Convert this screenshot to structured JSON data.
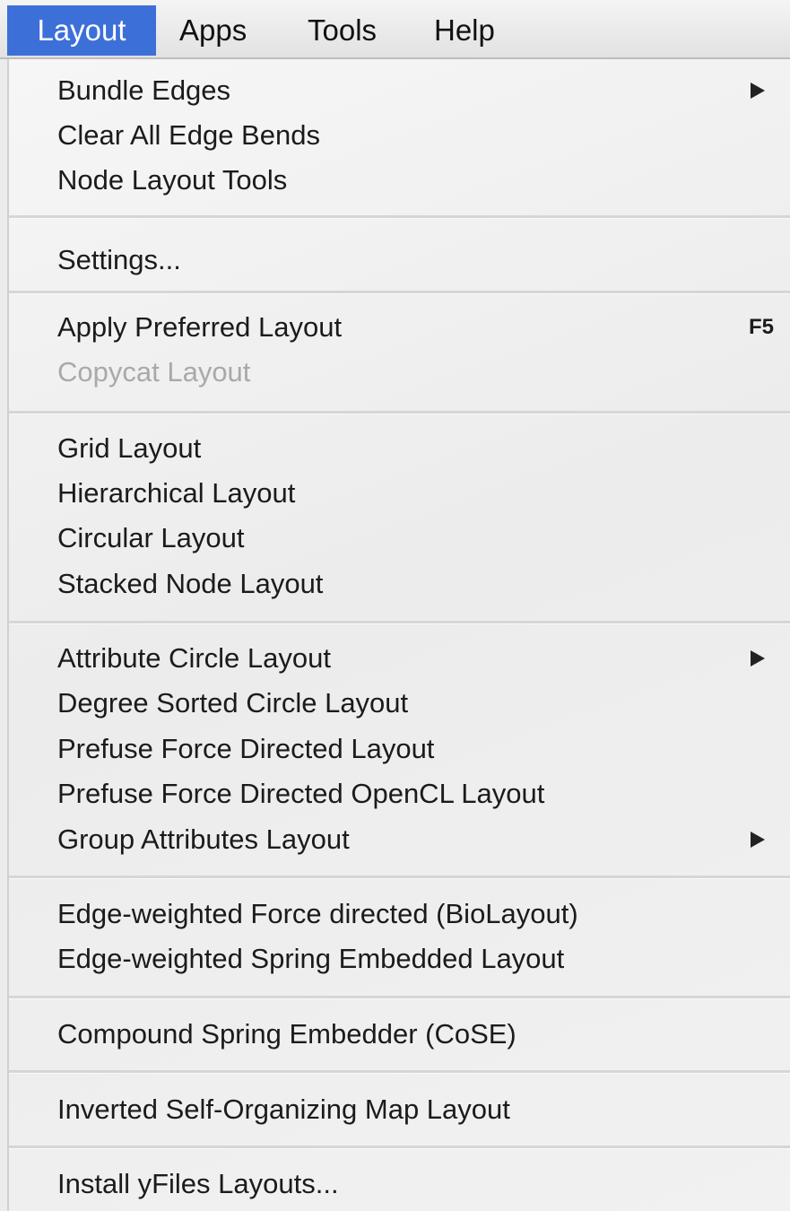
{
  "menubar": {
    "items": [
      "Layout",
      "Apps",
      "Tools",
      "Help"
    ]
  },
  "menu": {
    "groups": [
      {
        "items": [
          {
            "label": "Bundle Edges",
            "submenu": true
          },
          {
            "label": "Clear All Edge Bends"
          },
          {
            "label": "Node Layout Tools"
          }
        ]
      },
      {
        "items": [
          {
            "label": "Settings..."
          }
        ]
      },
      {
        "items": [
          {
            "label": "Apply Preferred Layout",
            "shortcut": "F5"
          },
          {
            "label": "Copycat Layout",
            "disabled": true
          }
        ]
      },
      {
        "items": [
          {
            "label": "Grid Layout"
          },
          {
            "label": "Hierarchical Layout"
          },
          {
            "label": "Circular Layout"
          },
          {
            "label": "Stacked Node Layout"
          }
        ]
      },
      {
        "items": [
          {
            "label": "Attribute Circle Layout",
            "submenu": true
          },
          {
            "label": "Degree Sorted Circle Layout"
          },
          {
            "label": "Prefuse Force Directed Layout"
          },
          {
            "label": "Prefuse Force Directed OpenCL Layout"
          },
          {
            "label": "Group Attributes Layout",
            "submenu": true
          }
        ]
      },
      {
        "items": [
          {
            "label": "Edge-weighted Force directed (BioLayout)"
          },
          {
            "label": "Edge-weighted Spring Embedded Layout"
          }
        ]
      },
      {
        "items": [
          {
            "label": "Compound Spring Embedder (CoSE)"
          }
        ]
      },
      {
        "items": [
          {
            "label": "Inverted Self-Organizing Map Layout"
          }
        ]
      },
      {
        "items": [
          {
            "label": "Install yFiles Layouts..."
          }
        ]
      }
    ]
  },
  "colors": {
    "accent": "#3d6fd8",
    "disabled_text": "#a9a9a9"
  }
}
